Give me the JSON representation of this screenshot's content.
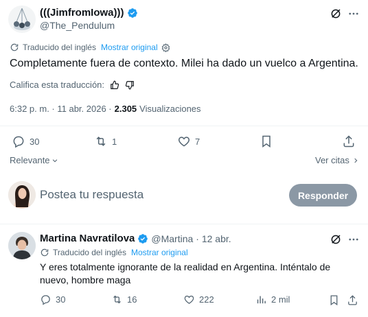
{
  "tweet": {
    "author_name": "(((JimfromIowa)))",
    "handle": "@The_Pendulum",
    "translation_label": "Traducido del inglés",
    "show_original": "Mostrar original",
    "text": "Completamente fuera de contexto. Milei ha dado un vuelco a Argentina.",
    "rate_translation": "Califica esta traducción:",
    "time": "6:32 p. m. · 11 abr. 2026 ·",
    "views_count": "2.305",
    "views_label": "Visualizaciones",
    "replies": "30",
    "reposts": "1",
    "likes": "7"
  },
  "sort": {
    "relevant_label": "Relevante",
    "quotes_label": "Ver citas"
  },
  "composer": {
    "placeholder": "Postea tu respuesta",
    "reply_button": "Responder"
  },
  "reply": {
    "author_name": "Martina Navratilova",
    "handle": "@Martina",
    "date": "· 12 abr.",
    "translation_label": "Traducido del inglés",
    "show_original": "Mostrar original",
    "text": "Y eres totalmente ignorante de la realidad en Argentina. Inténtalo de nuevo, hombre maga",
    "replies": "30",
    "reposts": "16",
    "likes": "222",
    "views": "2 mil"
  },
  "colors": {
    "accent": "#1d9bf0",
    "muted": "#536471",
    "button_disabled": "#8b98a5"
  },
  "icons": [
    "grok-icon",
    "more-icon",
    "translate-icon",
    "settings-icon",
    "thumbs-up-icon",
    "thumbs-down-icon",
    "reply-icon",
    "repost-icon",
    "like-icon",
    "bookmark-icon",
    "share-icon",
    "views-icon",
    "chevron-down-icon",
    "chevron-right-icon",
    "verified-icon"
  ]
}
